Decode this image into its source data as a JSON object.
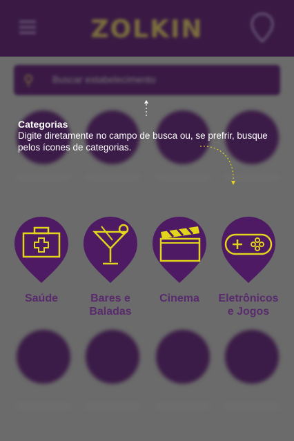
{
  "app": {
    "logo": "ZOLKIN"
  },
  "search": {
    "placeholder": "Buscar estabelecimento"
  },
  "tooltip": {
    "title": "Categorias",
    "body": "Digite diretamente no campo de busca ou, se prefrir, busque pelos ícones de categorias."
  },
  "categories": [
    {
      "label": "Saúde",
      "icon": "first-aid-kit-icon"
    },
    {
      "label": "Bares e Baladas",
      "icon": "cocktail-icon"
    },
    {
      "label": "Cinema",
      "icon": "clapperboard-icon"
    },
    {
      "label": "Eletrônicos e Jogos",
      "icon": "gamepad-icon"
    }
  ],
  "colors": {
    "overlay": "#6b6b6b",
    "pin": "#4d1a63",
    "icon": "#e3d51c",
    "label": "#5a2a6e",
    "tooltip_text": "#ffffff"
  }
}
